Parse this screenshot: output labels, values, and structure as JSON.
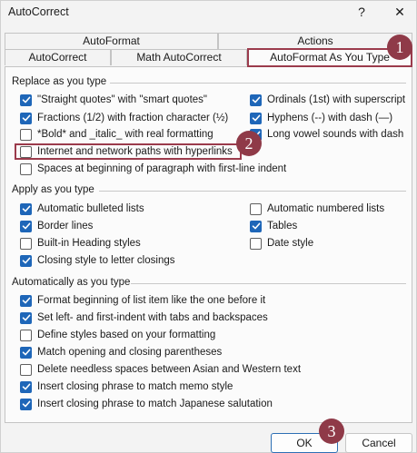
{
  "window": {
    "title": "AutoCorrect",
    "help_glyph": "?",
    "close_glyph": "✕"
  },
  "tabs": {
    "row1": [
      "AutoFormat",
      "Actions"
    ],
    "row2": [
      "AutoCorrect",
      "Math AutoCorrect",
      "AutoFormat As You Type"
    ],
    "active": "AutoFormat As You Type"
  },
  "sections": {
    "replace": {
      "label": "Replace as you type",
      "left": [
        {
          "label": "\"Straight quotes\" with \"smart quotes\"",
          "checked": true
        },
        {
          "label": "Fractions (1/2) with fraction character (½)",
          "checked": true
        },
        {
          "label": "*Bold* and _italic_ with real formatting",
          "checked": false
        },
        {
          "label": "Internet and network paths with hyperlinks",
          "checked": false
        }
      ],
      "right": [
        {
          "label": "Ordinals (1st) with superscript",
          "checked": true
        },
        {
          "label": "Hyphens (--) with dash (—)",
          "checked": true
        },
        {
          "label": "Long vowel sounds with dash",
          "checked": true
        }
      ],
      "full": {
        "label": "Spaces at beginning of paragraph with first-line indent",
        "checked": false
      }
    },
    "apply": {
      "label": "Apply as you type",
      "left": [
        {
          "label": "Automatic bulleted lists",
          "checked": true
        },
        {
          "label": "Border lines",
          "checked": true
        },
        {
          "label": "Built-in Heading styles",
          "checked": false
        },
        {
          "label": "Closing style to letter closings",
          "checked": true
        }
      ],
      "right": [
        {
          "label": "Automatic numbered lists",
          "checked": false
        },
        {
          "label": "Tables",
          "checked": true
        },
        {
          "label": "Date style",
          "checked": false
        }
      ]
    },
    "auto": {
      "label": "Automatically as you type",
      "items": [
        {
          "label": "Format beginning of list item like the one before it",
          "checked": true
        },
        {
          "label": "Set left- and first-indent with tabs and backspaces",
          "checked": true
        },
        {
          "label": "Define styles based on your formatting",
          "checked": false
        },
        {
          "label": "Match opening and closing parentheses",
          "checked": true
        },
        {
          "label": "Delete needless spaces between Asian and Western text",
          "checked": false
        },
        {
          "label": "Insert closing phrase to match memo style",
          "checked": true
        },
        {
          "label": "Insert closing phrase to match Japanese salutation",
          "checked": true
        }
      ]
    }
  },
  "buttons": {
    "ok": "OK",
    "cancel": "Cancel"
  },
  "callouts": [
    "1",
    "2",
    "3"
  ],
  "colors": {
    "accent": "#1e66b8",
    "callout": "#8f3a48"
  }
}
